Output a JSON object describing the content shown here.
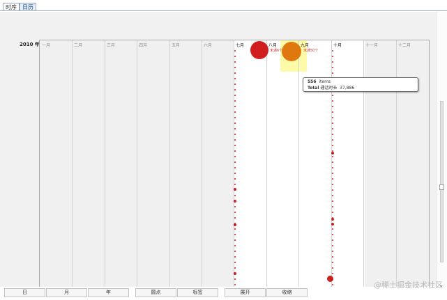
{
  "tabs": [
    {
      "label": "时序",
      "active": false
    },
    {
      "label": "日历",
      "active": true
    }
  ],
  "timeline": {
    "year_label": "2010 年",
    "months": [
      "一月",
      "二月",
      "三月",
      "四月",
      "五月",
      "六月",
      "七月",
      "八月",
      "九月",
      "十月",
      "十一月",
      "十二月"
    ],
    "bubbles": [
      {
        "month": "八月",
        "label": "未通6个",
        "color": "#d11f1f"
      },
      {
        "month": "九月",
        "label": "未通50个",
        "color": "#e07810",
        "highlight_color": "#fdfba8"
      }
    ],
    "accent_color": "#c92121"
  },
  "tooltip": {
    "count": "556",
    "unit": "items",
    "total_label": "Total",
    "duration_label": "通话时长",
    "duration_value": "37,886"
  },
  "toolbar": {
    "buttons": [
      "日",
      "月",
      "年",
      "圆点",
      "标签",
      "展开",
      "收缩"
    ]
  },
  "watermark": "@稀土掘金技术社区"
}
